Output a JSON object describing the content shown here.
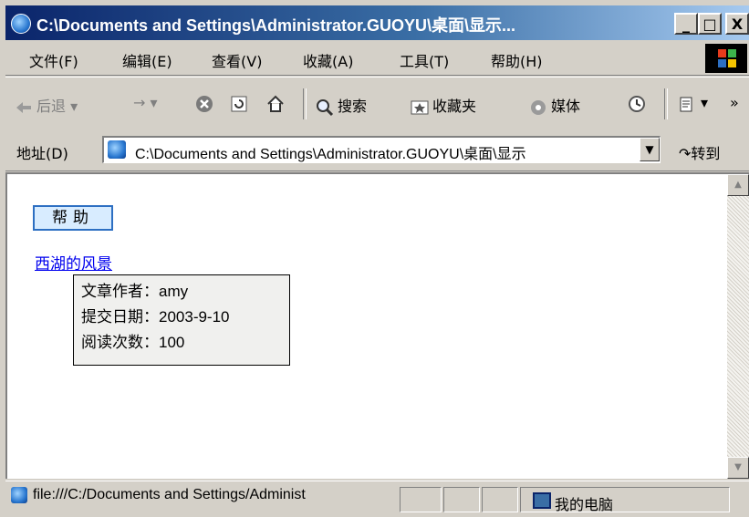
{
  "window": {
    "title": "C:\\Documents and Settings\\Administrator.GUOYU\\桌面\\显示...",
    "minimize": "_",
    "restore": "□",
    "close": "X"
  },
  "menu": [
    "文件(F)",
    "编辑(E)",
    "查看(V)",
    "收藏(A)",
    "工具(T)",
    "帮助(H)"
  ],
  "toolbar": {
    "back": "后退",
    "forward_arrow": "→",
    "search": "搜索",
    "favorites": "收藏夹",
    "media": "媒体",
    "more": "»"
  },
  "address": {
    "label": "地址(D)",
    "value": "C:\\Documents and Settings\\Administrator.GUOYU\\桌面\\显示",
    "go": "转到"
  },
  "content": {
    "help_button": "帮助",
    "link": "西湖的风景",
    "tooltip": [
      "文章作者：amy",
      "提交日期：2003-9-10",
      "阅读次数：100"
    ]
  },
  "status": {
    "text": "file:///C:/Documents and Settings/Administ",
    "zone": "我的电脑"
  },
  "colors": {
    "title_start": "#0a246a",
    "title_end": "#a6caf0",
    "link": "#0000ee",
    "button_border": "#2d6fc2"
  },
  "icons": [
    "ie-page-icon",
    "back-arrow-icon",
    "forward-arrow-icon",
    "stop-icon",
    "refresh-icon",
    "home-icon",
    "search-icon",
    "favorites-icon",
    "media-icon",
    "history-icon",
    "mail-icon",
    "windows-logo-icon",
    "computer-icon"
  ]
}
